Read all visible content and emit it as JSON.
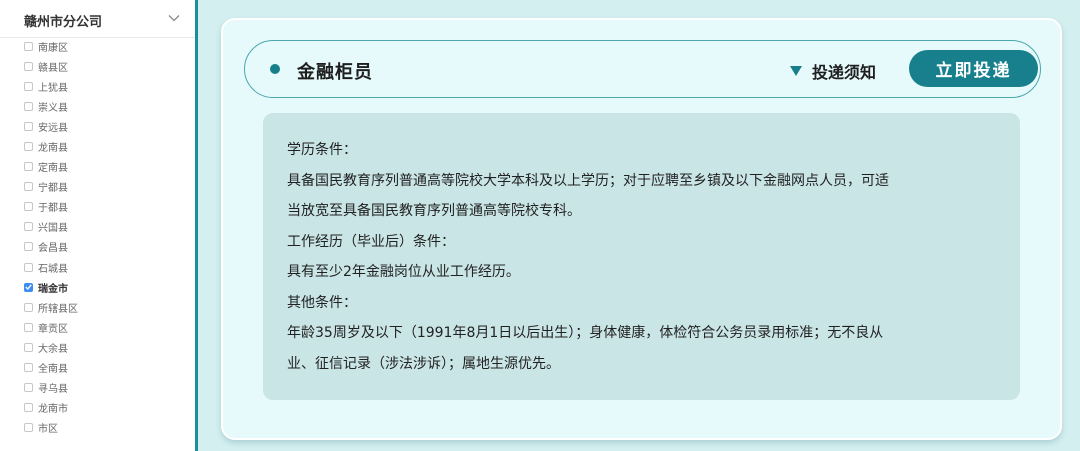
{
  "sidebar": {
    "title": "赣州市分公司",
    "districts": [
      {
        "label": "南康区",
        "checked": false
      },
      {
        "label": "赣县区",
        "checked": false
      },
      {
        "label": "上犹县",
        "checked": false
      },
      {
        "label": "崇义县",
        "checked": false
      },
      {
        "label": "安远县",
        "checked": false
      },
      {
        "label": "龙南县",
        "checked": false
      },
      {
        "label": "定南县",
        "checked": false
      },
      {
        "label": "宁都县",
        "checked": false
      },
      {
        "label": "于都县",
        "checked": false
      },
      {
        "label": "兴国县",
        "checked": false
      },
      {
        "label": "会昌县",
        "checked": false
      },
      {
        "label": "石城县",
        "checked": false
      },
      {
        "label": "瑞金市",
        "checked": true
      },
      {
        "label": "所辖县区",
        "checked": false
      },
      {
        "label": "章贡区",
        "checked": false
      },
      {
        "label": "大余县",
        "checked": false
      },
      {
        "label": "全南县",
        "checked": false
      },
      {
        "label": "寻乌县",
        "checked": false
      },
      {
        "label": "龙南市",
        "checked": false
      },
      {
        "label": "市区",
        "checked": false
      }
    ]
  },
  "job": {
    "title": "金融柜员",
    "notice_label": "投递须知",
    "apply_label": "立即投递"
  },
  "requirements": {
    "lines": [
      "学历条件：",
      "具备国民教育序列普通高等院校大学本科及以上学历；对于应聘至乡镇及以下金融网点人员，可适",
      "当放宽至具备国民教育序列普通高等院校专科。",
      "工作经历（毕业后）条件：",
      "具有至少2年金融岗位从业工作经历。",
      "其他条件：",
      "年龄35周岁及以下（1991年8月1日以后出生）；身体健康，体检符合公务员录用标准；无不良从",
      "业、征信记录（涉法涉诉）；属地生源优先。"
    ]
  },
  "colors": {
    "accent": "#17808c",
    "checkbox_checked": "#3d8df2",
    "page_background": "#d3eff0",
    "card_background": "#e7fafb",
    "requirements_background": "#cae5e6"
  },
  "icons": {
    "sidebar_toggle": "chevron-down-icon",
    "job_marker": "dot-icon",
    "notice_toggle": "triangle-down-icon"
  }
}
